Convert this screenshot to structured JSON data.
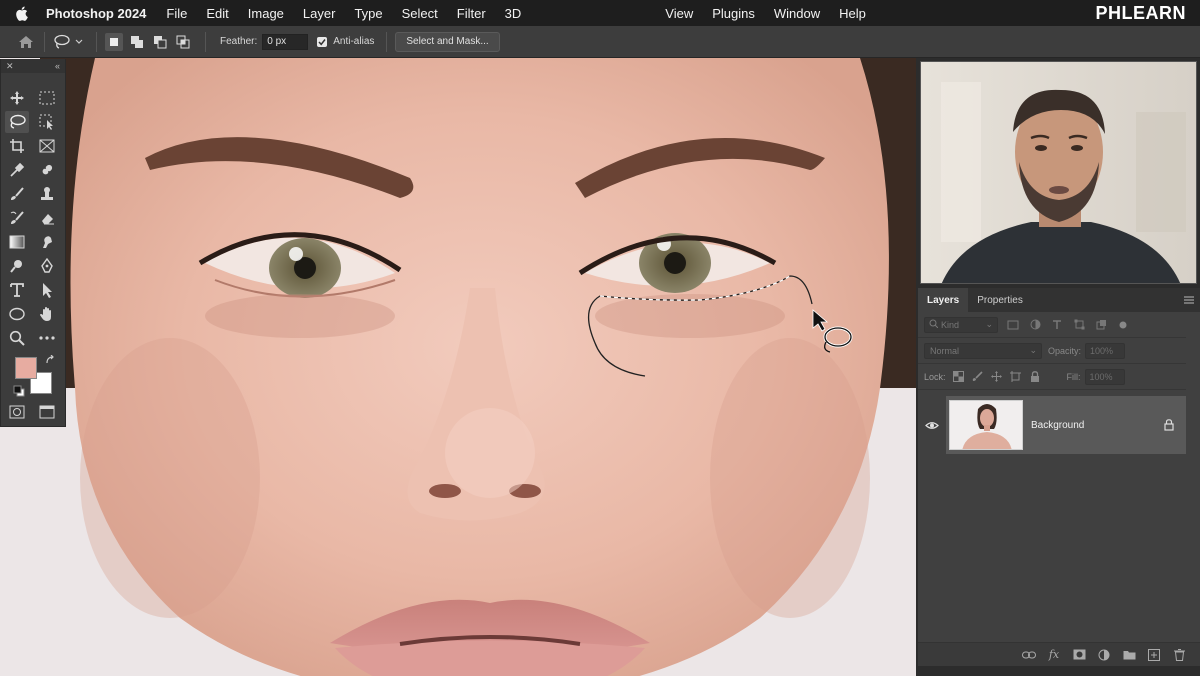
{
  "menubar": {
    "app_name": "Photoshop 2024",
    "menus": [
      "File",
      "Edit",
      "Image",
      "Layer",
      "Type",
      "Select",
      "Filter",
      "3D"
    ],
    "menus_right": [
      "View",
      "Plugins",
      "Window",
      "Help"
    ],
    "brand": "PHLEARN"
  },
  "options_bar": {
    "active_tool": "lasso-tool",
    "feather_label": "Feather:",
    "feather_value": "0 px",
    "anti_alias_label": "Anti-alias",
    "anti_alias_checked": true,
    "select_mask_label": "Select and Mask..."
  },
  "toolbar": {
    "tools": [
      "move-tool",
      "rectangular-marquee-tool",
      "lasso-tool",
      "object-selection-tool",
      "crop-tool",
      "frame-tool",
      "eyedropper-tool",
      "spot-healing-brush-tool",
      "brush-tool",
      "clone-stamp-tool",
      "history-brush-tool",
      "eraser-tool",
      "gradient-tool",
      "smudge-tool",
      "dodge-tool",
      "pen-tool",
      "type-tool",
      "path-selection-tool",
      "ellipse-tool",
      "hand-tool",
      "zoom-tool",
      "more-tools"
    ],
    "foreground_color": "#e7aca1",
    "background_color": "#ffffff"
  },
  "layers_panel": {
    "tabs": [
      "Layers",
      "Properties"
    ],
    "active_tab": "Layers",
    "kind_label": "Kind",
    "blend_mode": "Normal",
    "opacity_label": "Opacity:",
    "opacity_value": "100%",
    "lock_label": "Lock:",
    "fill_label": "Fill:",
    "fill_value": "100%",
    "layers": [
      {
        "name": "Background",
        "visible": true,
        "locked": true
      }
    ],
    "footer_icons": [
      "link-layers-icon",
      "fx-icon",
      "add-mask-icon",
      "adjustment-layer-icon",
      "new-group-icon",
      "new-layer-icon",
      "delete-layer-icon"
    ]
  },
  "canvas": {
    "content": "portrait-photo"
  }
}
